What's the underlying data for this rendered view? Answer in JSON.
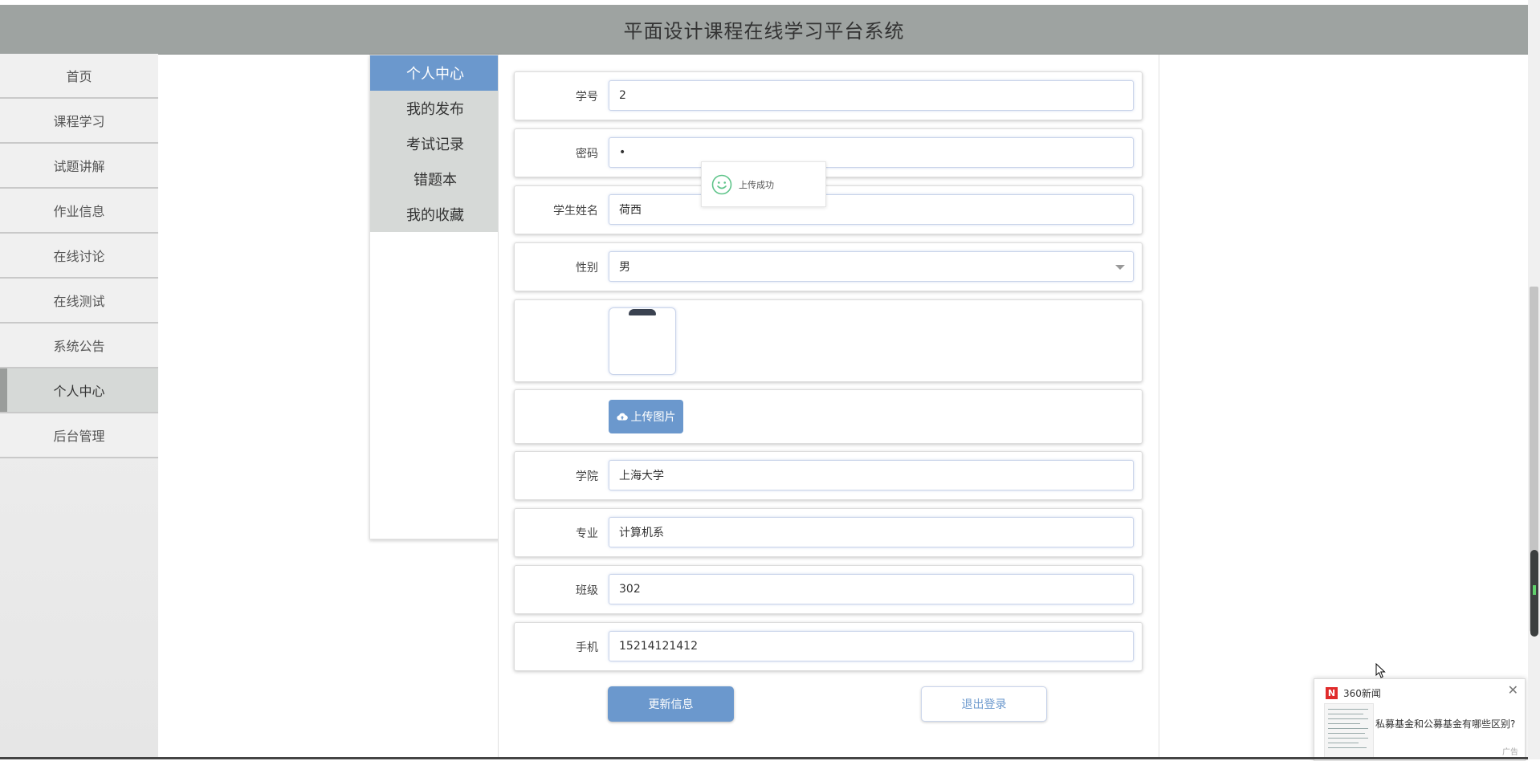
{
  "header": {
    "title": "平面设计课程在线学习平台系统"
  },
  "sidebar": {
    "items": [
      {
        "label": "首页",
        "active": false
      },
      {
        "label": "课程学习",
        "active": false
      },
      {
        "label": "试题讲解",
        "active": false
      },
      {
        "label": "作业信息",
        "active": false
      },
      {
        "label": "在线讨论",
        "active": false
      },
      {
        "label": "在线测试",
        "active": false
      },
      {
        "label": "系统公告",
        "active": false
      },
      {
        "label": "个人中心",
        "active": true
      },
      {
        "label": "后台管理",
        "active": false
      }
    ]
  },
  "left_panel": {
    "items": [
      {
        "label": "个人中心",
        "active": true
      },
      {
        "label": "我的发布",
        "active": false
      },
      {
        "label": "考试记录",
        "active": false
      },
      {
        "label": "错题本",
        "active": false
      },
      {
        "label": "我的收藏",
        "active": false
      }
    ]
  },
  "form": {
    "student_id": {
      "label": "学号",
      "value": "2"
    },
    "password": {
      "label": "密码",
      "value": "•"
    },
    "student_name": {
      "label": "学生姓名",
      "value": "荷西"
    },
    "gender": {
      "label": "性别",
      "value": "男"
    },
    "upload_button": "上传图片",
    "college": {
      "label": "学院",
      "value": "上海大学"
    },
    "major": {
      "label": "专业",
      "value": "计算机系"
    },
    "class": {
      "label": "班级",
      "value": "302"
    },
    "phone": {
      "label": "手机",
      "value": "15214121412"
    },
    "update_button": "更新信息",
    "logout_button": "退出登录"
  },
  "toast": {
    "text": "上传成功"
  },
  "news_popup": {
    "source": "360新闻",
    "headline": "私募基金和公募基金有哪些区别?",
    "ad_label": "广告"
  },
  "colors": {
    "header_bg": "#9ea3a1",
    "accent": "#6b98cd",
    "sidebar_active": "#d6d9d7"
  }
}
